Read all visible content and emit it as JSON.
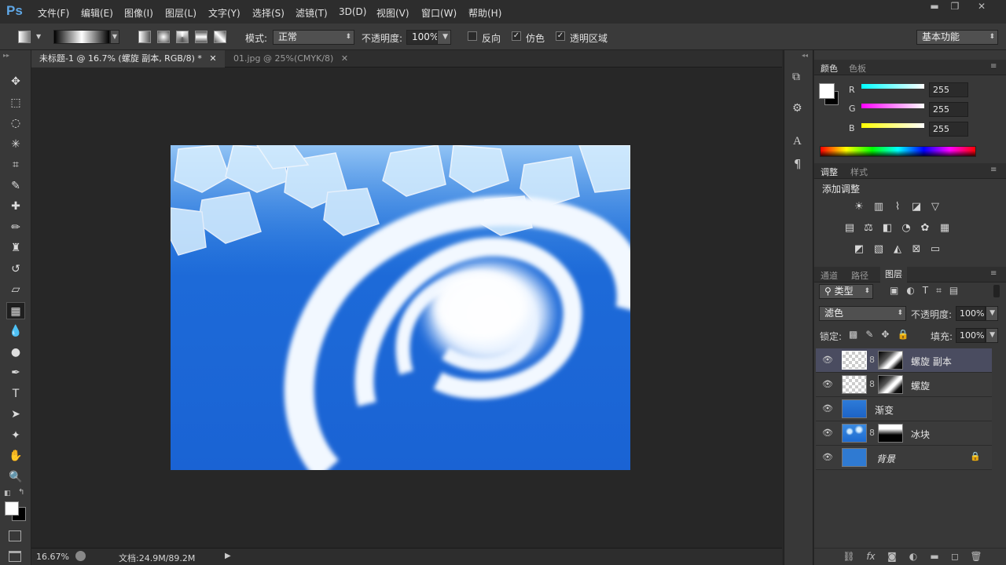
{
  "app": {
    "logo": "Ps"
  },
  "menu": [
    "文件(F)",
    "编辑(E)",
    "图像(I)",
    "图层(L)",
    "文字(Y)",
    "选择(S)",
    "滤镜(T)",
    "3D(D)",
    "视图(V)",
    "窗口(W)",
    "帮助(H)"
  ],
  "window_controls": {
    "minimize": "▬",
    "restore": "❐",
    "close": "✕"
  },
  "options": {
    "mode_label": "模式:",
    "mode_value": "正常",
    "opacity_label": "不透明度:",
    "opacity_value": "100%",
    "reverse_label": "反向",
    "dither_label": "仿色",
    "transparency_label": "透明区域",
    "workspace": "基本功能"
  },
  "tabs": [
    {
      "label": "未标题-1 @ 16.7% (螺旋 副本, RGB/8) *",
      "close": "✕"
    },
    {
      "label": "01.jpg @ 25%(CMYK/8)",
      "close": "✕"
    }
  ],
  "tools": [
    {
      "name": "move-tool-icon",
      "glyph": "✥"
    },
    {
      "name": "marquee-tool-icon",
      "glyph": "⬚"
    },
    {
      "name": "lasso-tool-icon",
      "glyph": "◌"
    },
    {
      "name": "magic-wand-tool-icon",
      "glyph": "✳"
    },
    {
      "name": "crop-tool-icon",
      "glyph": "⌗"
    },
    {
      "name": "eyedropper-tool-icon",
      "glyph": "✎"
    },
    {
      "name": "healing-brush-tool-icon",
      "glyph": "✚"
    },
    {
      "name": "brush-tool-icon",
      "glyph": "✏"
    },
    {
      "name": "clone-stamp-tool-icon",
      "glyph": "♜"
    },
    {
      "name": "history-brush-tool-icon",
      "glyph": "↺"
    },
    {
      "name": "eraser-tool-icon",
      "glyph": "▱"
    },
    {
      "name": "gradient-tool-icon",
      "glyph": "▦"
    },
    {
      "name": "blur-tool-icon",
      "glyph": "💧"
    },
    {
      "name": "dodge-tool-icon",
      "glyph": "●"
    },
    {
      "name": "pen-tool-icon",
      "glyph": "✒"
    },
    {
      "name": "type-tool-icon",
      "glyph": "T"
    },
    {
      "name": "path-selection-tool-icon",
      "glyph": "➤"
    },
    {
      "name": "shape-tool-icon",
      "glyph": "✦"
    },
    {
      "name": "hand-tool-icon",
      "glyph": "✋"
    },
    {
      "name": "zoom-tool-icon",
      "glyph": "🔍"
    }
  ],
  "status": {
    "zoom": "16.67%",
    "doc": "文档:24.9M/89.2M"
  },
  "color_panel": {
    "tabs": [
      "颜色",
      "色板"
    ],
    "channels": [
      {
        "label": "R",
        "value": "255",
        "gradient_color": "#00ffff"
      },
      {
        "label": "G",
        "value": "255",
        "gradient_color": "#ff00ff"
      },
      {
        "label": "B",
        "value": "255",
        "gradient_color": "#ffff00"
      }
    ]
  },
  "adjust_panel": {
    "tabs": [
      "调整",
      "样式"
    ],
    "title": "添加调整"
  },
  "layers_panel": {
    "tabs": [
      "通道",
      "路径",
      "图层"
    ],
    "filter_kind": "类型",
    "blend_mode": "滤色",
    "opacity_label": "不透明度:",
    "opacity_value": "100%",
    "lock_label": "锁定:",
    "fill_label": "填充:",
    "fill_value": "100%",
    "layers": [
      {
        "name": "螺旋 副本",
        "selected": true,
        "type": "mask"
      },
      {
        "name": "螺旋",
        "selected": false,
        "type": "mask"
      },
      {
        "name": "渐变",
        "selected": false,
        "type": "solid"
      },
      {
        "name": "冰块",
        "selected": false,
        "type": "ice"
      },
      {
        "name": "背景",
        "selected": false,
        "type": "background",
        "locked": true
      }
    ]
  }
}
